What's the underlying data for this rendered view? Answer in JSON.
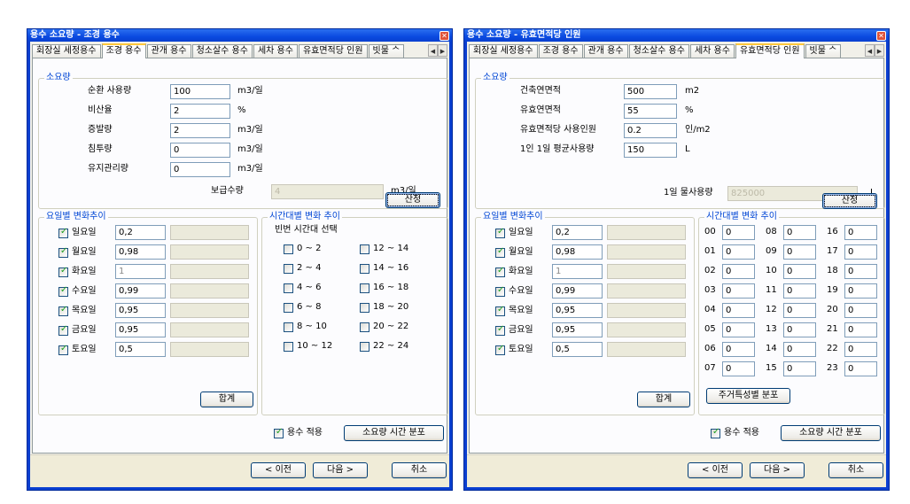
{
  "left": {
    "title": "용수 소요량 - 조경 용수",
    "tabs": [
      {
        "label": "회장실 세정용수",
        "active": false
      },
      {
        "label": "조경 용수",
        "active": true
      },
      {
        "label": "관개 용수",
        "active": false
      },
      {
        "label": "청소살수 용수",
        "active": false
      },
      {
        "label": "세차 용수",
        "active": false
      },
      {
        "label": "유효면적당 인원",
        "active": false
      },
      {
        "label": "빗물 ᄉ",
        "active": false
      }
    ],
    "demand_group": {
      "title": "소요량",
      "rows": [
        {
          "label": "순환 사용량",
          "value": "100",
          "unit": "m3/일"
        },
        {
          "label": "비산율",
          "value": "2",
          "unit": "%"
        },
        {
          "label": "증발량",
          "value": "2",
          "unit": "m3/일"
        },
        {
          "label": "침투량",
          "value": "0",
          "unit": "m3/일"
        },
        {
          "label": "유지관리량",
          "value": "0",
          "unit": "m3/일"
        }
      ],
      "result_label": "보급수량",
      "result_value": "4",
      "result_unit": "m3/일",
      "calc_button": "산정"
    },
    "weekday_group": {
      "title": "요일별 변화추이",
      "days": [
        {
          "label": "일요일",
          "checked": true,
          "value": "0,2",
          "enabled": true
        },
        {
          "label": "월요일",
          "checked": true,
          "value": "0,98",
          "enabled": true
        },
        {
          "label": "화요일",
          "checked": true,
          "value": "1",
          "enabled": false
        },
        {
          "label": "수요일",
          "checked": true,
          "value": "0,99",
          "enabled": true
        },
        {
          "label": "목요일",
          "checked": true,
          "value": "0,95",
          "enabled": true
        },
        {
          "label": "금요일",
          "checked": true,
          "value": "0,95",
          "enabled": true
        },
        {
          "label": "토요일",
          "checked": true,
          "value": "0,5",
          "enabled": true
        }
      ],
      "sum_button": "합계"
    },
    "hourly_group": {
      "title": "시간대별 변화 추이",
      "subtitle": "빈번 시간대 선택",
      "ranges_col1": [
        "0 ~ 2",
        "2 ~ 4",
        "4 ~ 6",
        "6 ~ 8",
        "8 ~ 10",
        "10 ~ 12"
      ],
      "ranges_col2": [
        "12 ~ 14",
        "14 ~ 16",
        "16 ~ 18",
        "18 ~ 20",
        "20 ~ 22",
        "22 ~ 24"
      ]
    },
    "apply_checkbox": {
      "label": "용수 적용",
      "checked": true
    },
    "distribution_button": "소요량 시간 분포",
    "footer": {
      "prev": "< 이전",
      "next": "다음 >",
      "cancel": "취소"
    }
  },
  "right": {
    "title": "용수 소요량 - 유효면적당 인원",
    "tabs": [
      {
        "label": "회장실 세정용수",
        "active": false
      },
      {
        "label": "조경 용수",
        "active": false
      },
      {
        "label": "관개 용수",
        "active": false
      },
      {
        "label": "청소살수 용수",
        "active": false
      },
      {
        "label": "세차 용수",
        "active": false
      },
      {
        "label": "유효면적당 인원",
        "active": true
      },
      {
        "label": "빗물 ᄉ",
        "active": false
      }
    ],
    "demand_group": {
      "title": "소요량",
      "rows": [
        {
          "label": "건축연면적",
          "value": "500",
          "unit": "m2"
        },
        {
          "label": "유효연면적",
          "value": "55",
          "unit": "%"
        },
        {
          "label": "유효면적당 사용인원",
          "value": "0.2",
          "unit": "인/m2"
        },
        {
          "label": "1인 1일 평균사용량",
          "value": "150",
          "unit": "L"
        }
      ],
      "result_label": "1일 물사용량",
      "result_value": "825000",
      "result_unit": "L",
      "calc_button": "산정"
    },
    "weekday_group": {
      "title": "요일별 변화추이",
      "days": [
        {
          "label": "일요일",
          "checked": true,
          "value": "0,2",
          "enabled": true
        },
        {
          "label": "월요일",
          "checked": true,
          "value": "0,98",
          "enabled": true
        },
        {
          "label": "화요일",
          "checked": true,
          "value": "1",
          "enabled": false
        },
        {
          "label": "수요일",
          "checked": true,
          "value": "0,99",
          "enabled": true
        },
        {
          "label": "목요일",
          "checked": true,
          "value": "0,95",
          "enabled": true
        },
        {
          "label": "금요일",
          "checked": true,
          "value": "0,95",
          "enabled": true
        },
        {
          "label": "토요일",
          "checked": true,
          "value": "0,5",
          "enabled": true
        }
      ],
      "sum_button": "합계"
    },
    "hourly_group": {
      "title": "시간대별 변화 추이",
      "hours": [
        {
          "label": "00",
          "value": "0"
        },
        {
          "label": "01",
          "value": "0"
        },
        {
          "label": "02",
          "value": "0"
        },
        {
          "label": "03",
          "value": "0"
        },
        {
          "label": "04",
          "value": "0"
        },
        {
          "label": "05",
          "value": "0"
        },
        {
          "label": "06",
          "value": "0"
        },
        {
          "label": "07",
          "value": "0"
        },
        {
          "label": "08",
          "value": "0"
        },
        {
          "label": "09",
          "value": "0"
        },
        {
          "label": "10",
          "value": "0"
        },
        {
          "label": "11",
          "value": "0"
        },
        {
          "label": "12",
          "value": "0"
        },
        {
          "label": "13",
          "value": "0"
        },
        {
          "label": "14",
          "value": "0"
        },
        {
          "label": "15",
          "value": "0"
        },
        {
          "label": "16",
          "value": "0"
        },
        {
          "label": "17",
          "value": "0"
        },
        {
          "label": "18",
          "value": "0"
        },
        {
          "label": "19",
          "value": "0"
        },
        {
          "label": "20",
          "value": "0"
        },
        {
          "label": "21",
          "value": "0"
        },
        {
          "label": "22",
          "value": "0"
        },
        {
          "label": "23",
          "value": "0"
        }
      ],
      "residential_button": "주거특성별 분포"
    },
    "apply_checkbox": {
      "label": "용수 적용",
      "checked": true
    },
    "distribution_button": "소요량 시간 분포",
    "footer": {
      "prev": "< 이전",
      "next": "다음 >",
      "cancel": "취소"
    }
  }
}
